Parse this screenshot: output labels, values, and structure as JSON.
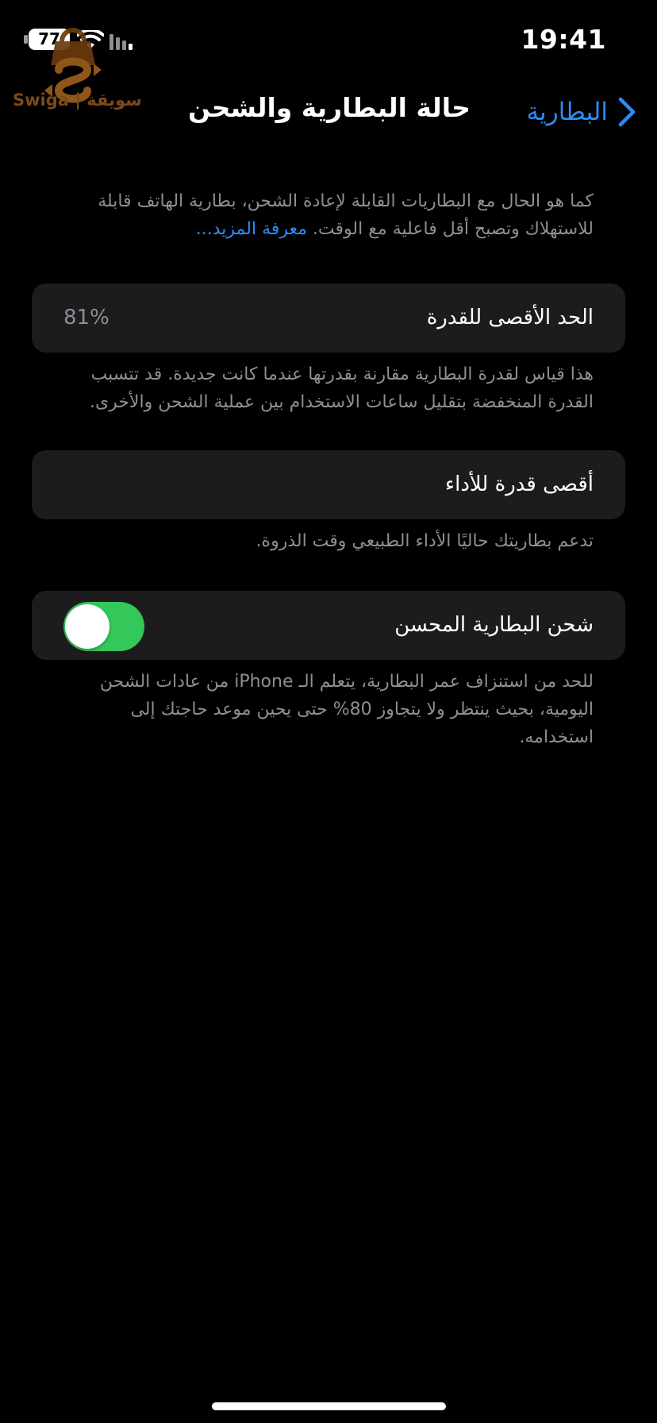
{
  "status_bar": {
    "time": "19:41",
    "battery_level": "77",
    "icons": [
      "wifi-icon",
      "signal-icon",
      "battery-icon"
    ]
  },
  "watermark": {
    "text": "Swiga | سويقة",
    "icon": "swiga-logo-icon"
  },
  "nav": {
    "title": "حالة البطارية والشحن",
    "back_label": "البطارية",
    "back_icon": "chevron-right-icon"
  },
  "intro": {
    "text": "كما هو الحال مع البطاريات القابلة لإعادة الشحن، بطارية الهاتف قابلة للاستهلاك وتصبح أقل فاعلية مع الوقت.",
    "learn_more": "معرفة المزيد..."
  },
  "max_capacity": {
    "label": "الحد الأقصى للقدرة",
    "value": "81%",
    "footer": "هذا قياس لقدرة البطارية مقارنة بقدرتها عندما كانت جديدة. قد تتسبب القدرة المنخفضة بتقليل ساعات الاستخدام بين عملية الشحن والأخرى."
  },
  "peak_performance": {
    "label": "أقصى قدرة للأداء",
    "footer": "تدعم بطاريتك حاليًا الأداء الطبيعي وقت الذروة."
  },
  "optimized_charging": {
    "label": "شحن البطارية المحسن",
    "enabled": true,
    "footer": "للحد من استنزاف عمر البطارية، يتعلم الـ iPhone من عادات الشحن اليومية، بحيث ينتظر ولا يتجاوز 80% حتى يحين موعد حاجتك إلى استخدامه."
  },
  "colors": {
    "background": "#000000",
    "cell": "#1c1c1e",
    "accent": "#2b8cf5",
    "toggle_on": "#34c759",
    "secondary_text": "#8e8e93"
  }
}
